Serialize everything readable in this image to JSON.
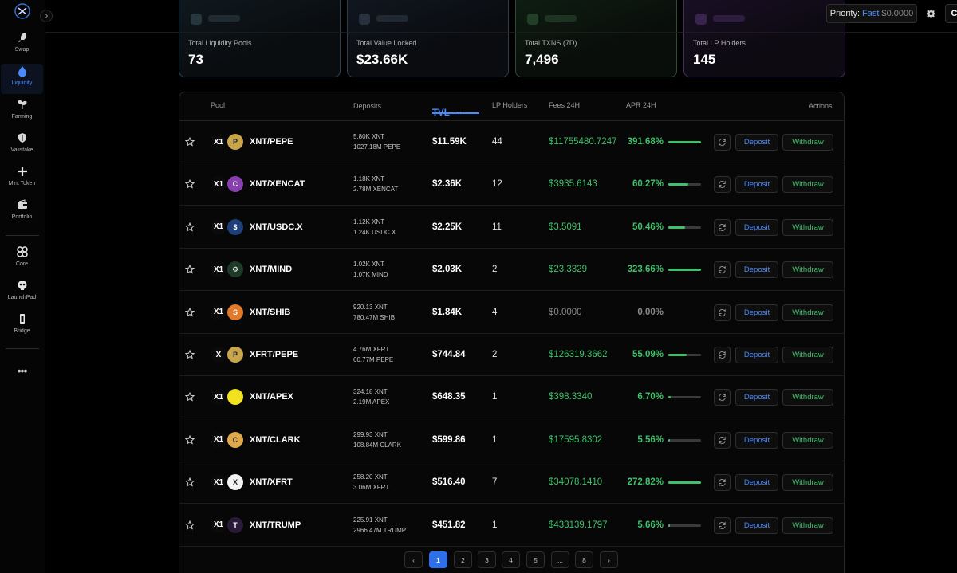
{
  "sidebar": {
    "items": [
      {
        "label": "Swap",
        "icon": "rocket-icon"
      },
      {
        "label": "Liquidity",
        "icon": "droplet-icon",
        "active": true
      },
      {
        "label": "Farming",
        "icon": "sprout-icon"
      },
      {
        "label": "Valistake",
        "icon": "shield-icon"
      },
      {
        "label": "Mint Token",
        "icon": "plus-icon"
      },
      {
        "label": "Portfolio",
        "icon": "wallet-icon"
      },
      {
        "label": "Core",
        "icon": "core-icon"
      },
      {
        "label": "LaunchPad",
        "icon": "skull-icon"
      },
      {
        "label": "Bridge",
        "icon": "bridge-icon"
      }
    ],
    "more": "•••"
  },
  "topbar": {
    "priority_key": "Priority:",
    "priority_mode": "Fast",
    "priority_fee": "$0.0000",
    "connect_label": "Connect"
  },
  "stats": [
    {
      "label": "Total Liquidity Pools",
      "value": "73"
    },
    {
      "label": "Total Value Locked",
      "value": "$23.66K"
    },
    {
      "label": "Total TXNS (7D)",
      "value": "7,496"
    },
    {
      "label": "Total LP Holders",
      "value": "145"
    }
  ],
  "table": {
    "headers": {
      "pool": "Pool",
      "deposits": "Deposits",
      "tvl": "TVL",
      "lp_holders": "LP Holders",
      "fees": "Fees 24H",
      "apr": "APR 24H",
      "actions": "Actions"
    },
    "deposit_label": "Deposit",
    "withdraw_label": "Withdraw",
    "rows": [
      {
        "pair": "XNT/PEPE",
        "dep1": "5.80K XNT",
        "dep2": "1027.18M PEPE",
        "tvl": "$11.59K",
        "lp": "44",
        "fees": "$11755480.7247",
        "apr": "391.68%",
        "apr_fill": 1.0,
        "tok1": "X1",
        "tok2": "P",
        "tok2_color": "#c9a64a"
      },
      {
        "pair": "XNT/XENCAT",
        "dep1": "1.18K XNT",
        "dep2": "2.78M XENCAT",
        "tvl": "$2.36K",
        "lp": "12",
        "fees": "$3935.6143",
        "apr": "60.27%",
        "apr_fill": 0.6,
        "tok1": "X1",
        "tok2": "C",
        "tok2_color": "#8a3fb0"
      },
      {
        "pair": "XNT/USDC.X",
        "dep1": "1.12K XNT",
        "dep2": "1.24K USDC.X",
        "tvl": "$2.25K",
        "lp": "11",
        "fees": "$3.5091",
        "apr": "50.46%",
        "apr_fill": 0.5,
        "tok1": "X1",
        "tok2": "$",
        "tok2_color": "#1f3f7a"
      },
      {
        "pair": "XNT/MIND",
        "dep1": "1.02K XNT",
        "dep2": "1.07K MIND",
        "tvl": "$2.03K",
        "lp": "2",
        "fees": "$23.3329",
        "apr": "323.66%",
        "apr_fill": 1.0,
        "tok1": "X1",
        "tok2": "⚙",
        "tok2_color": "#1d3a28"
      },
      {
        "pair": "XNT/SHIB",
        "dep1": "920.13 XNT",
        "dep2": "780.47M SHIB",
        "tvl": "$1.84K",
        "lp": "4",
        "fees": "$0.0000",
        "apr": "0.00%",
        "apr_fill": 0,
        "tok1": "X1",
        "tok2": "S",
        "tok2_color": "#e07a2a"
      },
      {
        "pair": "XFRT/PEPE",
        "dep1": "4.76M XFRT",
        "dep2": "60.77M PEPE",
        "tvl": "$744.84",
        "lp": "2",
        "fees": "$126319.3662",
        "apr": "55.09%",
        "apr_fill": 0.55,
        "tok1": "X",
        "tok2": "P",
        "tok2_color": "#c9a64a"
      },
      {
        "pair": "XNT/APEX",
        "dep1": "324.18 XNT",
        "dep2": "2.19M APEX",
        "tvl": "$648.35",
        "lp": "1",
        "fees": "$398.3340",
        "apr": "6.70%",
        "apr_fill": 0.07,
        "tok1": "X1",
        "tok2": "",
        "tok2_color": "#f2e21f"
      },
      {
        "pair": "XNT/CLARK",
        "dep1": "299.93 XNT",
        "dep2": "108.84M CLARK",
        "tvl": "$599.86",
        "lp": "1",
        "fees": "$17595.8302",
        "apr": "5.56%",
        "apr_fill": 0.06,
        "tok1": "X1",
        "tok2": "C",
        "tok2_color": "#e0a84a"
      },
      {
        "pair": "XNT/XFRT",
        "dep1": "258.20 XNT",
        "dep2": "3.06M XFRT",
        "tvl": "$516.40",
        "lp": "7",
        "fees": "$34078.1410",
        "apr": "272.82%",
        "apr_fill": 1.0,
        "tok1": "X1",
        "tok2": "X",
        "tok2_color": "#f2f2f2"
      },
      {
        "pair": "XNT/TRUMP",
        "dep1": "225.91 XNT",
        "dep2": "2966.47M TRUMP",
        "tvl": "$451.82",
        "lp": "1",
        "fees": "$433139.1797",
        "apr": "5.66%",
        "apr_fill": 0.06,
        "tok1": "X1",
        "tok2": "T",
        "tok2_color": "#2a1a3a"
      }
    ]
  },
  "pagination": {
    "prev": "‹",
    "pages": [
      "1",
      "2",
      "3",
      "4",
      "5",
      "...",
      "8"
    ],
    "next": "›",
    "current": "1"
  },
  "colors": {
    "accent": "#4a8cff",
    "positive": "#3fc06a",
    "muted": "#8a8a8a"
  }
}
